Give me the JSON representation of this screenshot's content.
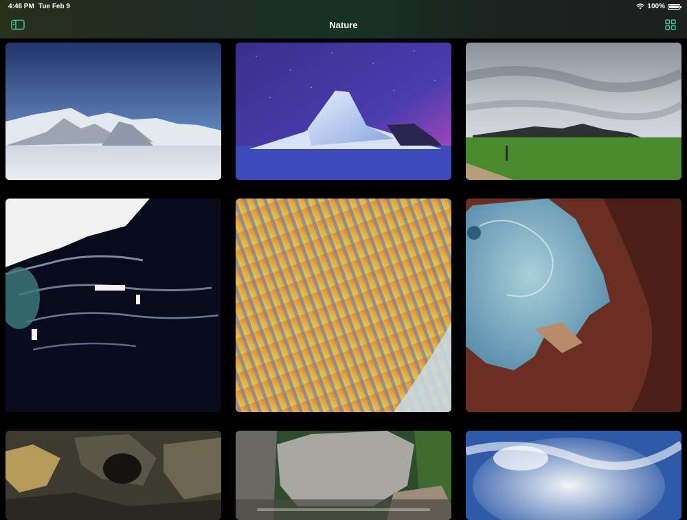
{
  "status_bar": {
    "time": "4:46 PM",
    "date": "Tue Feb 9",
    "battery": "100%"
  },
  "nav": {
    "title": "Nature"
  },
  "photos": [
    {
      "name": "antarctic-mountains"
    },
    {
      "name": "iceberg-night"
    },
    {
      "name": "grassland-hills"
    },
    {
      "name": "arctic-coast-aerial"
    },
    {
      "name": "desert-dunes-aerial"
    },
    {
      "name": "frozen-lake-aerial"
    },
    {
      "name": "rock-cave"
    },
    {
      "name": "boulders-forest"
    },
    {
      "name": "cloudy-sky"
    }
  ]
}
